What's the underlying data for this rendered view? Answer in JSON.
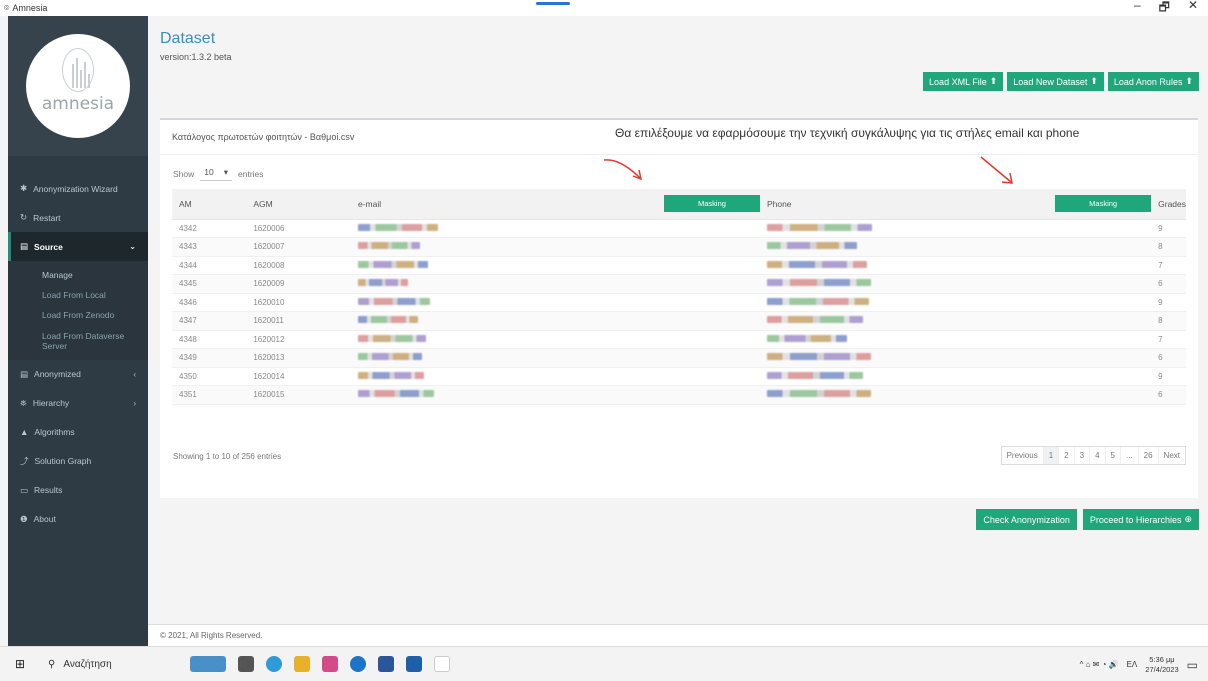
{
  "window": {
    "title": "Amnesia",
    "minimize": "–",
    "maximize": "🗗",
    "close": "✕"
  },
  "sidebar": {
    "logo_text": "amnesia",
    "items": [
      {
        "icon": "✱",
        "label": "Anonymization Wizard"
      },
      {
        "icon": "↻",
        "label": "Restart"
      },
      {
        "icon": "▤",
        "label": "Source",
        "chevron": "⌄"
      },
      {
        "icon": "▤",
        "label": "Anonymized",
        "chevron": "‹"
      },
      {
        "icon": "⛯",
        "label": "Hierarchy",
        "chevron": "›"
      },
      {
        "icon": "▲",
        "label": "Algorithms"
      },
      {
        "icon": "⤴",
        "label": "Solution Graph"
      },
      {
        "icon": "▭",
        "label": "Results"
      },
      {
        "icon": "❶",
        "label": "About"
      }
    ],
    "source_sub": [
      "Manage",
      "Load From Local",
      "Load From Zenodo",
      "Load From Dataverse Server"
    ]
  },
  "header": {
    "title": "Dataset",
    "version": "version:1.3.2 beta"
  },
  "top_actions": [
    "Load XML File",
    "Load New Dataset",
    "Load Anon Rules"
  ],
  "upload_icon": "⬆",
  "card": {
    "title": "Κατάλογος πρωτοετών φοιτητών - Βαθμοί.csv",
    "annotation": "Θα επιλέξουμε να εφαρμόσουμε την τεχνική συγκάλυψης για τις στήλες email και phone",
    "show_label": "Show",
    "entries_value": "10",
    "entries_caret": "▾",
    "entries_label": "entries",
    "mask_label": "Masking",
    "columns": [
      "AM",
      "AGM",
      "e-mail",
      "Phone",
      "Grades"
    ],
    "rows": [
      {
        "am": "4342",
        "agm": "1620006",
        "grade": "9"
      },
      {
        "am": "4343",
        "agm": "1620007",
        "grade": "8"
      },
      {
        "am": "4344",
        "agm": "1620008",
        "grade": "7"
      },
      {
        "am": "4345",
        "agm": "1620009",
        "grade": "6"
      },
      {
        "am": "4346",
        "agm": "1620010",
        "grade": "9"
      },
      {
        "am": "4347",
        "agm": "1620011",
        "grade": "8"
      },
      {
        "am": "4348",
        "agm": "1620012",
        "grade": "7"
      },
      {
        "am": "4349",
        "agm": "1620013",
        "grade": "6"
      },
      {
        "am": "4350",
        "agm": "1620014",
        "grade": "9"
      },
      {
        "am": "4351",
        "agm": "1620015",
        "grade": "6"
      }
    ],
    "showing": "Showing 1 to 10 of 256 entries",
    "pagination": [
      "Previous",
      "1",
      "2",
      "3",
      "4",
      "5",
      "...",
      "26",
      "Next"
    ]
  },
  "bottom_actions": {
    "check": "Check Anonymization",
    "proceed": "Proceed to Hierarchies",
    "proceed_icon": "⊕"
  },
  "footer": "© 2021, All Rights Reserved.",
  "taskbar": {
    "start_icon": "⊞",
    "search_icon": "⚲",
    "search": "Αναζήτηση",
    "tray_icons": "^ ⌂ ✉ ◔ 🔊",
    "lang": "ΕΛ",
    "time": "5:36 μμ",
    "date": "27/4/2023",
    "notification_icon": "▭"
  }
}
